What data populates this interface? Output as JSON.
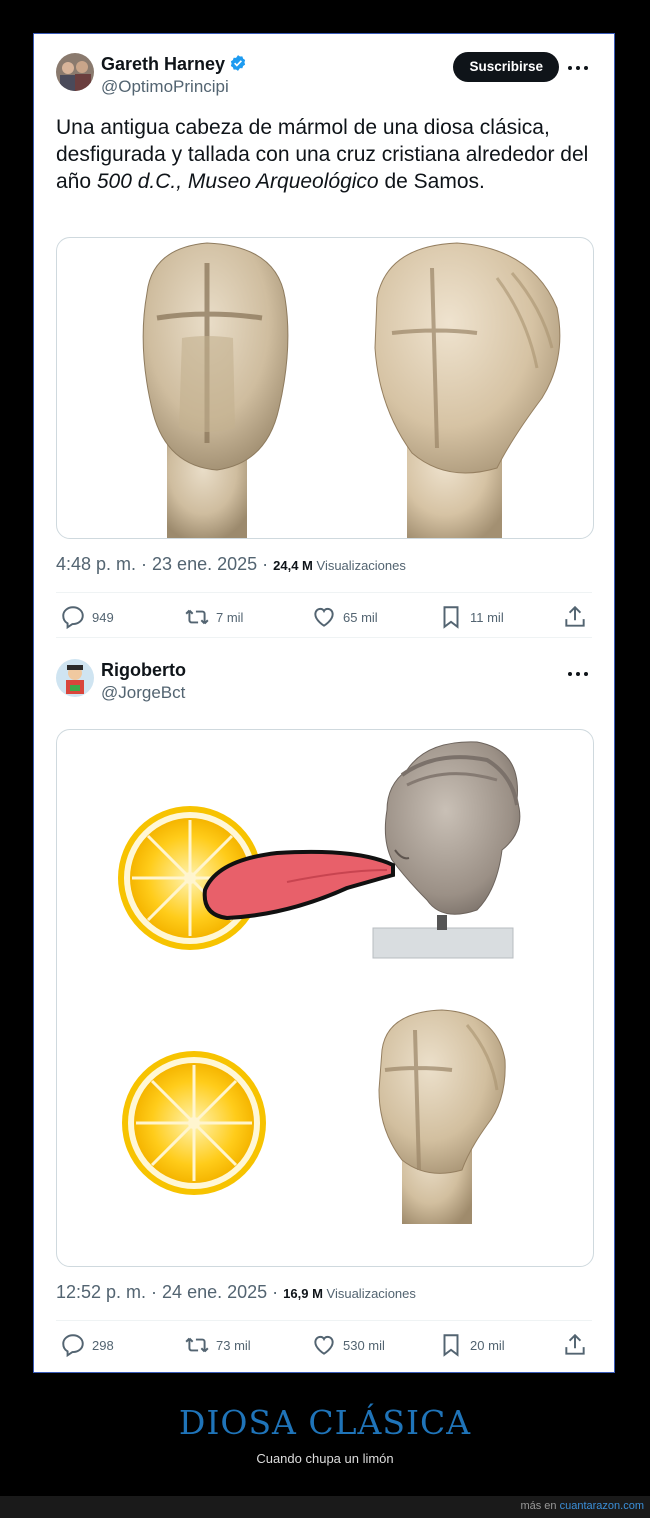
{
  "tweets": [
    {
      "name": "Gareth Harney",
      "handle": "@OptimoPrincipi",
      "subscribe_label": "Suscribirse",
      "text_parts": [
        "Una antigua cabeza de mármol de una diosa clásica, desfigurada y tallada con una cruz cristiana alrededor del año ",
        "500 d.C., Museo Arqueológico",
        " de Samos."
      ],
      "time": "4:48 p. m. · 23 ene. 2025 · ",
      "views_count": "24,4 M",
      "views_label": " Visualizaciones",
      "actions": {
        "reply": "949",
        "retweet": "7 mil",
        "like": "65 mil",
        "bookmark": "11 mil"
      }
    },
    {
      "name": "Rigoberto",
      "handle": "@JorgeBct",
      "time": "12:52 p. m. · 24 ene. 2025 · ",
      "views_count": "16,9 M",
      "views_label": " Visualizaciones",
      "actions": {
        "reply": "298",
        "retweet": "73 mil",
        "like": "530 mil",
        "bookmark": "20 mil"
      }
    }
  ],
  "post": {
    "title": "DIOSA CLÁSICA",
    "subtitle": "Cuando chupa un limón"
  },
  "footer": {
    "prefix": "más en ",
    "site": "cuantarazon.com"
  },
  "icons": [
    "verified-badge-icon",
    "more-icon",
    "reply-icon",
    "retweet-icon",
    "like-icon",
    "bookmark-icon",
    "share-icon"
  ],
  "colors": {
    "accent": "#1d9bf0",
    "title": "#1f74b9",
    "tongue": "#e8606a",
    "lemon": "#f7b800"
  }
}
